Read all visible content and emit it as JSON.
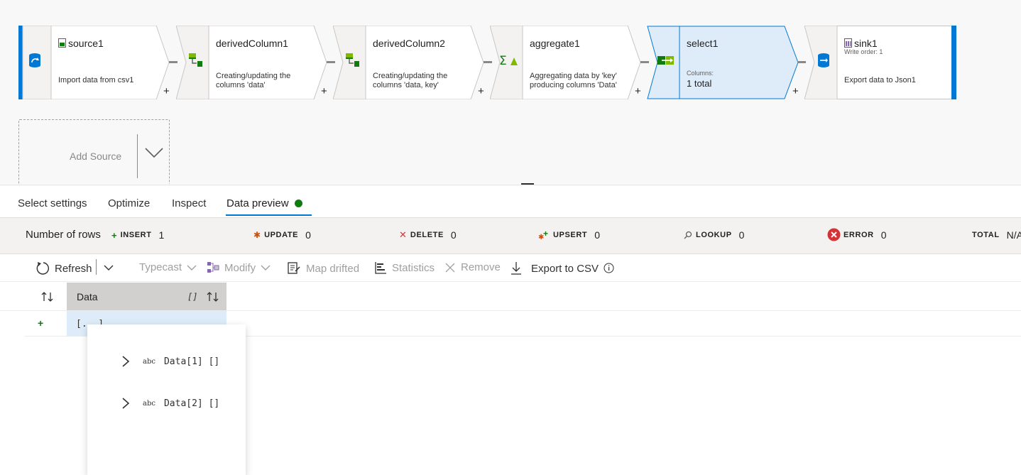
{
  "canvas": {
    "nodes": [
      {
        "name": "source1",
        "desc1": "Import data from csv1",
        "desc2": ""
      },
      {
        "name": "derivedColumn1",
        "desc1": "Creating/updating the",
        "desc2": "columns 'data'"
      },
      {
        "name": "derivedColumn2",
        "desc1": "Creating/updating the",
        "desc2": "columns 'data, key'"
      },
      {
        "name": "aggregate1",
        "desc1": "Aggregating data by 'key'",
        "desc2": "producing columns 'Data'"
      },
      {
        "name": "select1",
        "columns_label": "Columns:",
        "total": "1 total"
      },
      {
        "name": "sink1",
        "write_order": "Write order: 1",
        "desc1": "Export data to Json1"
      }
    ],
    "plus": "+",
    "add_source": "Add Source"
  },
  "tabs": [
    "Select settings",
    "Optimize",
    "Inspect",
    "Data preview"
  ],
  "stats": {
    "rows_label": "Number of rows",
    "insert": {
      "label": "INSERT",
      "value": "1"
    },
    "update": {
      "label": "UPDATE",
      "value": "0"
    },
    "delete": {
      "label": "DELETE",
      "value": "0"
    },
    "upsert": {
      "label": "UPSERT",
      "value": "0"
    },
    "lookup": {
      "label": "LOOKUP",
      "value": "0"
    },
    "error": {
      "label": "ERROR",
      "value": "0"
    },
    "total": {
      "label": "TOTAL",
      "value": "N/A"
    }
  },
  "toolbar": {
    "refresh": "Refresh",
    "typecast": "Typecast",
    "modify": "Modify",
    "map_drifted": "Map drifted",
    "statistics": "Statistics",
    "remove": "Remove",
    "export": "Export to CSV"
  },
  "grid": {
    "column": "Data",
    "column_type": "[]",
    "row_marker": "+",
    "cell_value": "[...]"
  },
  "popup": {
    "items": [
      {
        "type": "abc",
        "name": "Data[1] []"
      },
      {
        "type": "abc",
        "name": "Data[2] []"
      }
    ]
  },
  "colors": {
    "accent": "#0078d4",
    "selected_fill": "#deecf9",
    "success": "#107c10",
    "error": "#d13438"
  }
}
